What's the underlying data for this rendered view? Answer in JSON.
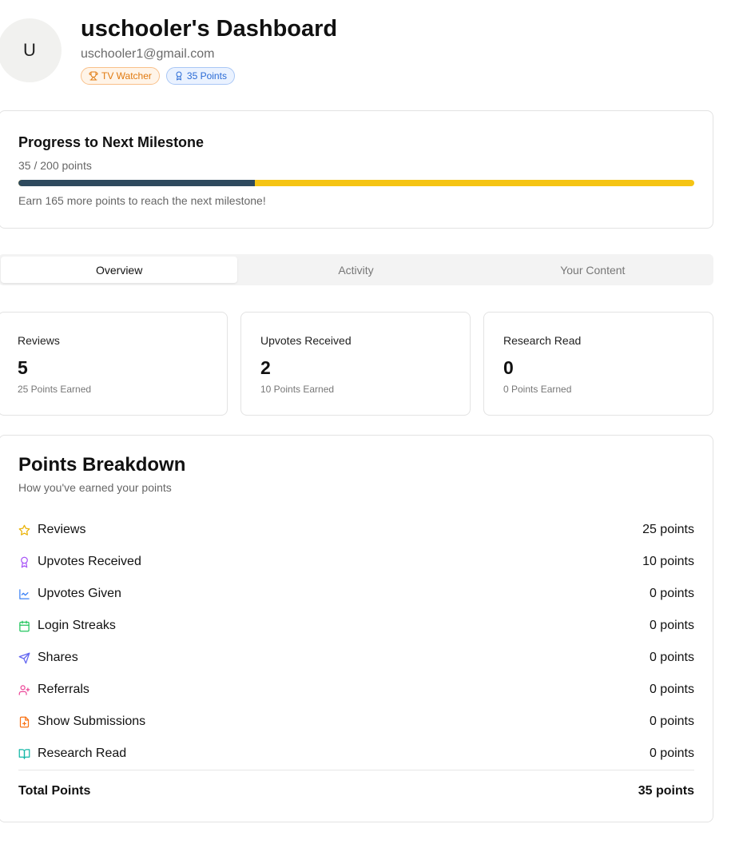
{
  "profile": {
    "avatar_initial": "U",
    "title": "uschooler's Dashboard",
    "email": "uschooler1@gmail.com",
    "badges": [
      {
        "label": "TV Watcher",
        "icon": "trophy-icon",
        "color": "#e07a10"
      },
      {
        "label": "35 Points",
        "icon": "award-icon",
        "color": "#2a6bd6"
      }
    ]
  },
  "milestone": {
    "title": "Progress to Next Milestone",
    "progress_text": "35 / 200 points",
    "current": 35,
    "target": 200,
    "progress_fraction": 0.35,
    "note": "Earn 165 more points to reach the next milestone!",
    "fill_color": "#2e4a5e",
    "track_color": "#f5c414"
  },
  "tabs": [
    {
      "label": "Overview",
      "active": true
    },
    {
      "label": "Activity",
      "active": false
    },
    {
      "label": "Your Content",
      "active": false
    }
  ],
  "stats": [
    {
      "label": "Reviews",
      "value": "5",
      "sub": "25 Points Earned"
    },
    {
      "label": "Upvotes Received",
      "value": "2",
      "sub": "10 Points Earned"
    },
    {
      "label": "Research Read",
      "value": "0",
      "sub": "0 Points Earned"
    }
  ],
  "breakdown": {
    "title": "Points Breakdown",
    "subtitle": "How you've earned your points",
    "rows": [
      {
        "name": "Reviews",
        "points": "25 points",
        "icon": "star-icon",
        "color": "#eab308"
      },
      {
        "name": "Upvotes Received",
        "points": "10 points",
        "icon": "award-icon",
        "color": "#a855f7"
      },
      {
        "name": "Upvotes Given",
        "points": "0 points",
        "icon": "line-chart-icon",
        "color": "#3b82f6"
      },
      {
        "name": "Login Streaks",
        "points": "0 points",
        "icon": "calendar-icon",
        "color": "#22c55e"
      },
      {
        "name": "Shares",
        "points": "0 points",
        "icon": "send-icon",
        "color": "#6366f1"
      },
      {
        "name": "Referrals",
        "points": "0 points",
        "icon": "user-plus-icon",
        "color": "#ec4899"
      },
      {
        "name": "Show Submissions",
        "points": "0 points",
        "icon": "file-plus-icon",
        "color": "#f97316"
      },
      {
        "name": "Research Read",
        "points": "0 points",
        "icon": "book-open-icon",
        "color": "#14b8a6"
      }
    ],
    "total_label": "Total Points",
    "total_value": "35 points"
  }
}
